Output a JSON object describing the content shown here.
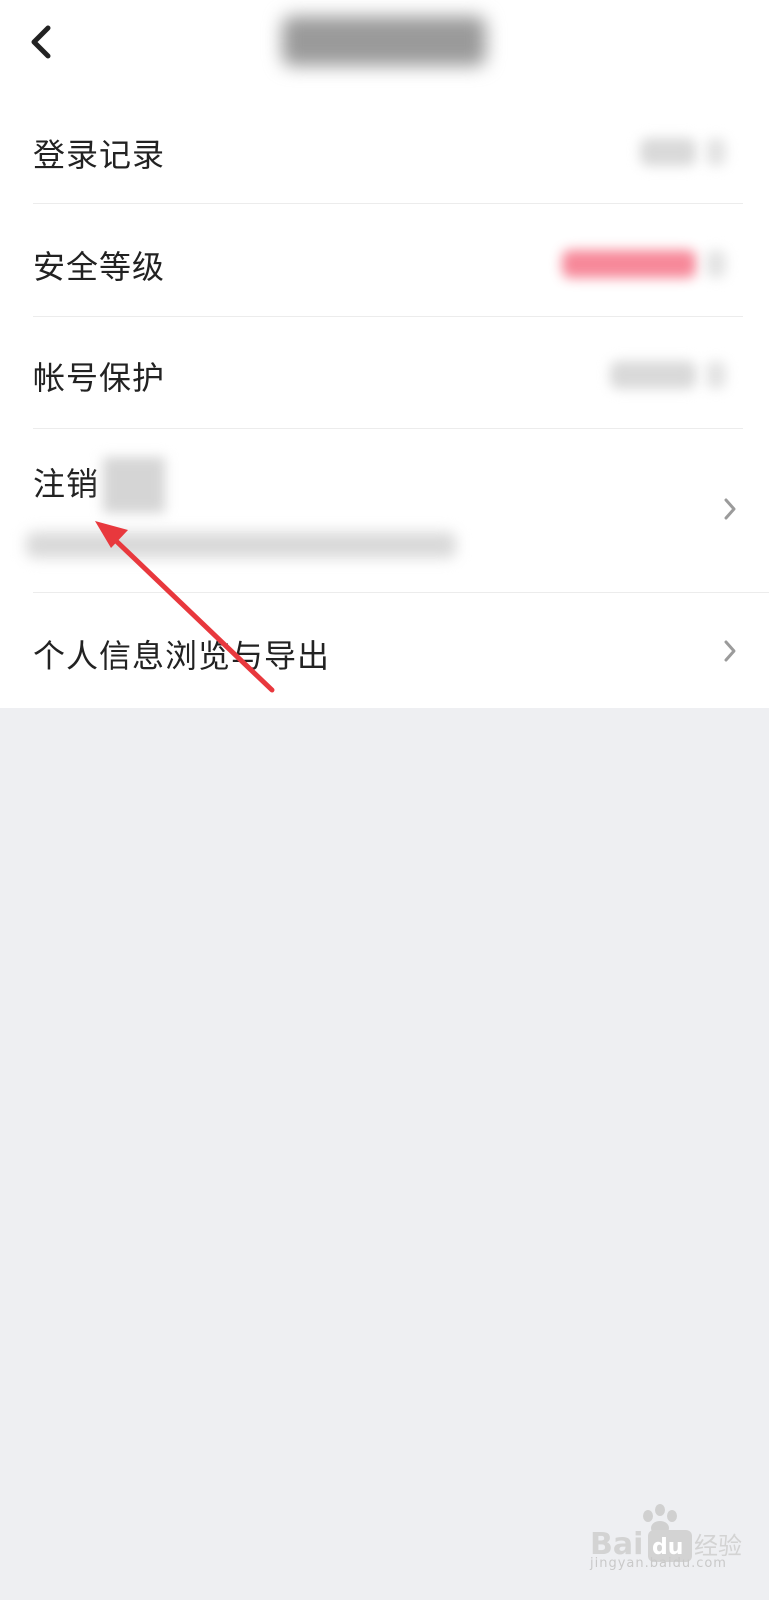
{
  "header": {
    "back_icon": "chevron-left-icon",
    "title_blurred": true
  },
  "rows": [
    {
      "label": "登录记录",
      "value_blurred": true,
      "value_color": "#d9d9d9",
      "chevron": true
    },
    {
      "label": "安全等级",
      "value_blurred": true,
      "value_color": "#f3566e",
      "chevron": true
    },
    {
      "label": "帐号保护",
      "value_blurred": true,
      "value_color": "#d9d9d9",
      "chevron": true
    },
    {
      "label": "注销",
      "label_tail_blurred": true,
      "subtitle_blurred": true,
      "chevron": true
    },
    {
      "label": "个人信息浏览与导出",
      "chevron": true
    }
  ],
  "annotation": {
    "type": "arrow",
    "color": "#e8383d"
  },
  "watermark": {
    "brand": "Baidu经验",
    "url": "jingyan.baidu.com"
  },
  "colors": {
    "panel": "#ffffff",
    "background": "#eeeff2",
    "text": "#222222",
    "chevron": "#9b9b9b"
  }
}
